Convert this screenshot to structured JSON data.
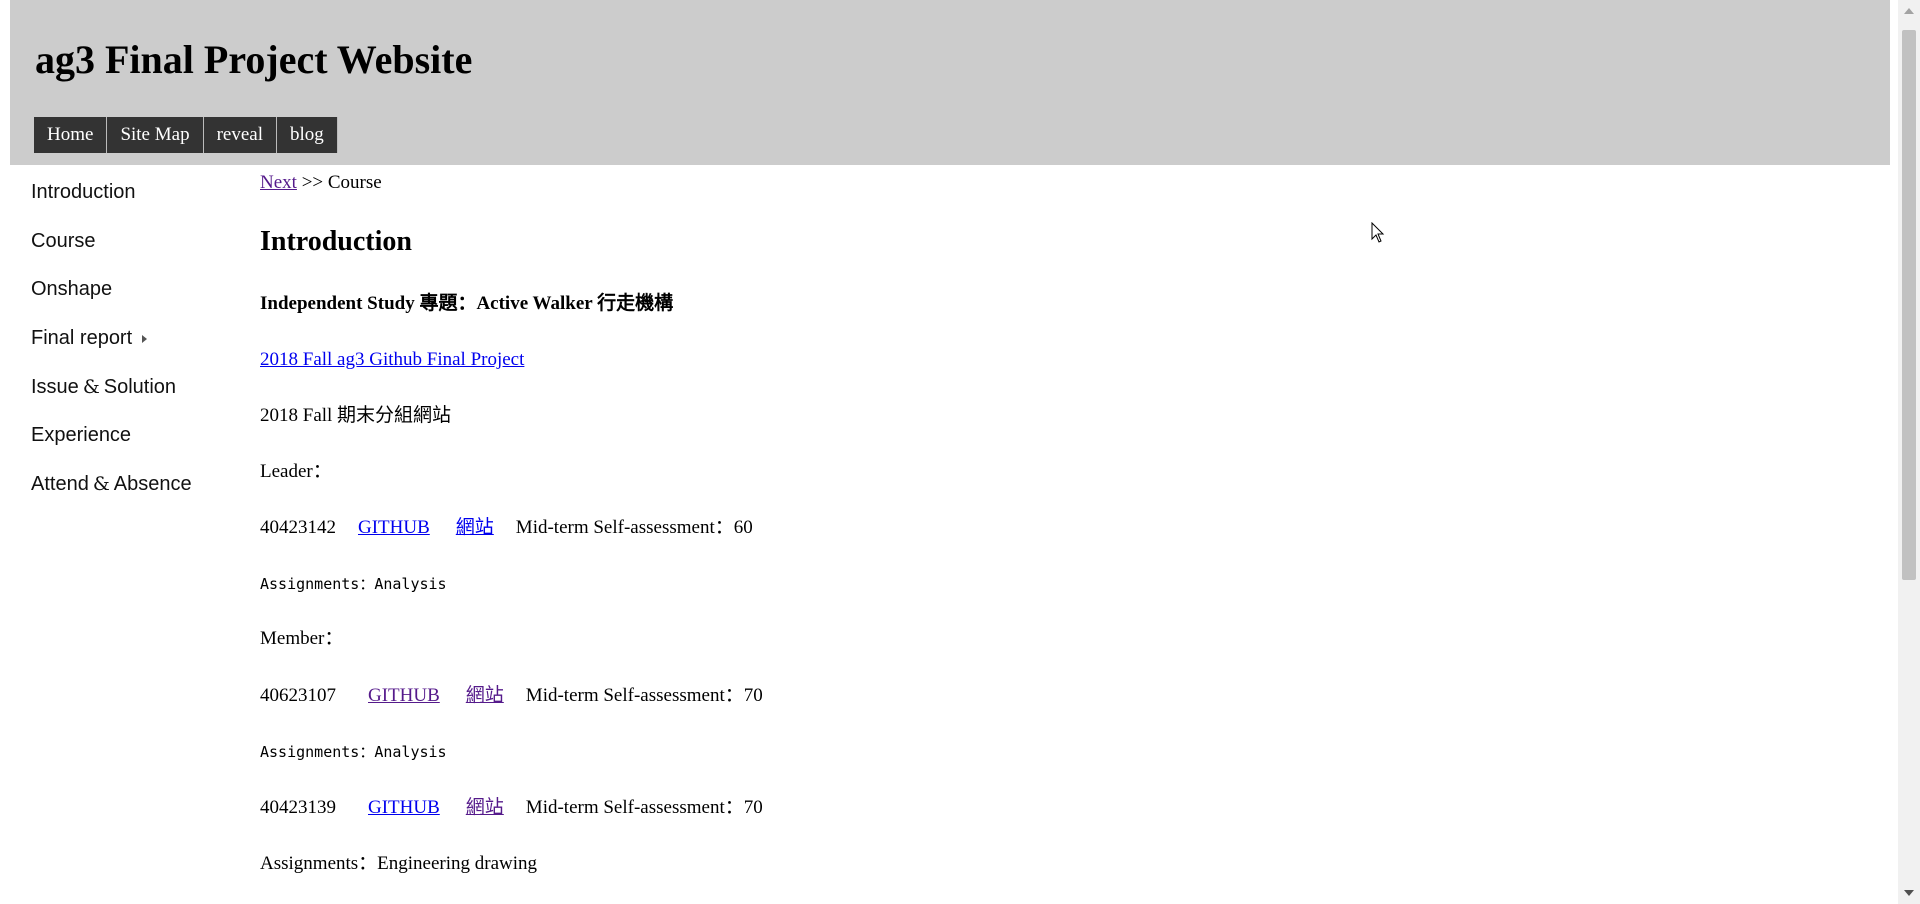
{
  "header": {
    "title": "ag3 Final Project Website",
    "nav": [
      "Home",
      "Site Map",
      "reveal",
      "blog"
    ]
  },
  "sidebar": {
    "items": [
      {
        "label": "Introduction"
      },
      {
        "label": "Course"
      },
      {
        "label": "Onshape"
      },
      {
        "label": "Final report"
      },
      {
        "label_a": "Issue",
        "amp": "&",
        "label_b": "Solution"
      },
      {
        "label": "Experience"
      },
      {
        "label_a": "Attend",
        "amp": "&",
        "label_b": "Absence"
      }
    ]
  },
  "breadcrumb": {
    "next_link": "Next",
    "separator": ">>",
    "current": "Course"
  },
  "content": {
    "heading": "Introduction",
    "subheading": "Independent Study 專題：Active Walker 行走機構",
    "project_link": "2018 Fall ag3 Github Final Project",
    "site_desc": "2018 Fall 期末分組網站",
    "leader_label": "Leader：",
    "leader": {
      "id": "40423142",
      "github": "GITHUB",
      "site": "網站",
      "assessment": "Mid-term Self-assessment：60",
      "assignments": "Assignments：Analysis"
    },
    "member_label": "Member：",
    "members": [
      {
        "id": "40623107",
        "github": "GITHUB",
        "site": "網站",
        "assessment": "Mid-term Self-assessment：70",
        "assignments": "Assignments：Analysis"
      },
      {
        "id": "40423139",
        "github": "GITHUB",
        "site": "網站",
        "assessment": "Mid-term Self-assessment：70",
        "assignments": "Assignments：Engineering drawing"
      }
    ]
  }
}
